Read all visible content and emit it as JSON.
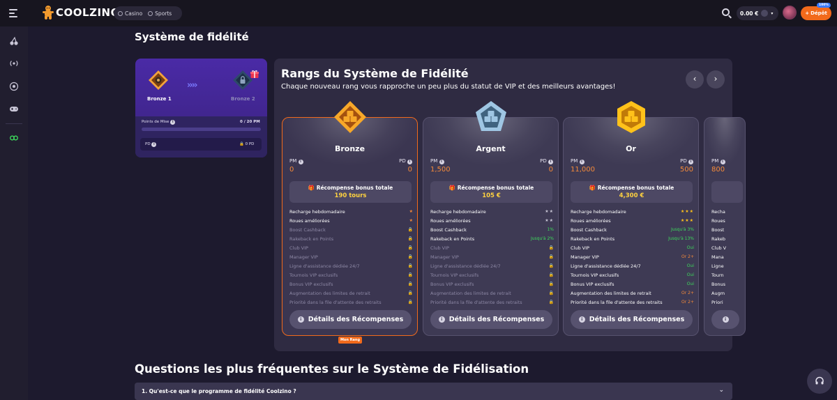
{
  "header": {
    "logo_text": "COOLZINO",
    "nav": [
      {
        "label": "Casino",
        "icon": "cherry-icon"
      },
      {
        "label": "Sports",
        "icon": "ball-icon"
      }
    ],
    "balance": "0.00 €",
    "deposit_label": "Dépôt",
    "deposit_badge": "100%"
  },
  "sidebar": {
    "icons": [
      "cherries-icon",
      "live-icon",
      "football-icon",
      "gamepad-icon",
      "promo-icon"
    ]
  },
  "page": {
    "title": "Système de fidélité"
  },
  "progress_card": {
    "current_rank": "Bronze 1",
    "next_rank": "Bronze 2",
    "points_label": "Points de Mise",
    "points_value": "0 / 20 PM",
    "points_progress_fraction": 0,
    "pd_label": "PD",
    "pd_value": "0 PD"
  },
  "ranks_panel": {
    "title": "Rangs du Système de Fidélité",
    "subtitle": "Chaque nouveau rang vous rapproche un peu plus du statut de VIP et des meilleurs avantages!",
    "prev_label": "‹",
    "next_label": "›",
    "pm_label": "PM",
    "pd_label": "PD",
    "reward_label": "Récompense bonus totale",
    "details_label": "Détails des Récompenses",
    "current_badge": "Mon Rang",
    "feature_labels": [
      "Recharge hebdomadaire",
      "Roues améliorées",
      "Boost Cashback",
      "Rakeback en Points",
      "Club VIP",
      "Manager VIP",
      "Ligne d'assistance dédiée 24/7",
      "Tournois VIP exclusifs",
      "Bonus VIP exclusifs",
      "Augmentation des limites de retrait",
      "Priorité dans la file d'attente des retraits"
    ],
    "tiers": [
      {
        "name": "Bronze",
        "pm": "0",
        "pd": "0",
        "reward": "190 tours",
        "values": [
          "★",
          "★",
          "🔒",
          "🔒",
          "🔒",
          "🔒",
          "🔒",
          "🔒",
          "🔒",
          "🔒",
          "🔒"
        ]
      },
      {
        "name": "Argent",
        "pm": "1,500",
        "pd": "0",
        "reward": "105 €",
        "values": [
          "★★",
          "★★",
          "1%",
          "Jusqu'à 2%",
          "🔒",
          "🔒",
          "🔒",
          "🔒",
          "🔒",
          "🔒",
          "🔒"
        ]
      },
      {
        "name": "Or",
        "pm": "11,000",
        "pd": "500",
        "reward": "4,300 €",
        "values": [
          "★★★",
          "★★★",
          "Jusqu'à 3%",
          "Jusqu'à 13%",
          "Oui",
          "Or 2+",
          "Oui",
          "Oui",
          "Oui",
          "Or 2+",
          "Or 2+"
        ]
      },
      {
        "name": "",
        "pm": "800",
        "pd": "",
        "reward": "",
        "values": [
          "",
          "",
          "",
          "",
          "",
          "",
          "",
          "",
          "",
          "",
          ""
        ]
      }
    ],
    "partial_labels": [
      "Recha",
      "Roues",
      "Boost",
      "Rakeb",
      "Club V",
      "Mana",
      "Ligne",
      "Tourn",
      "Bonus",
      "Augm",
      "Priori"
    ]
  },
  "faq": {
    "title": "Questions les plus fréquentes sur le Système de Fidélisation",
    "first_question": "1. Qu'est-ce que le programme de fidélité Coolzino ?"
  }
}
